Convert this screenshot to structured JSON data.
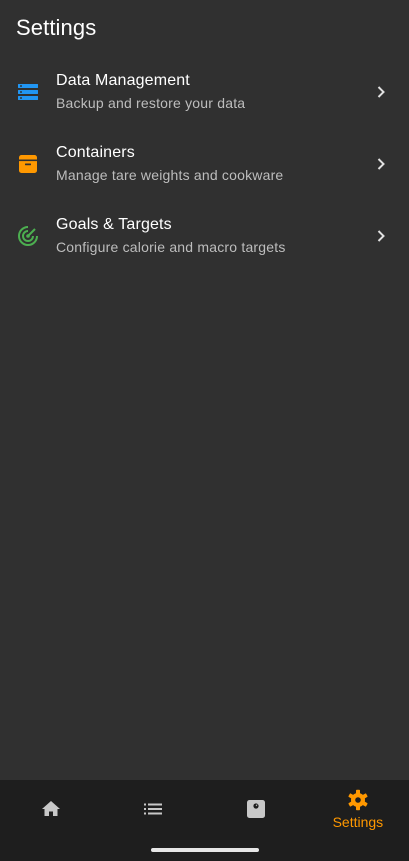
{
  "header": {
    "title": "Settings"
  },
  "settings": {
    "items": [
      {
        "icon": "storage-icon",
        "title": "Data Management",
        "subtitle": "Backup and restore your data",
        "icon_color": "#2196f3"
      },
      {
        "icon": "archive-box-icon",
        "title": "Containers",
        "subtitle": "Manage tare weights and cookware",
        "icon_color": "#ff9800"
      },
      {
        "icon": "target-icon",
        "title": "Goals & Targets",
        "subtitle": "Configure calorie and macro targets",
        "icon_color": "#4caf50"
      }
    ]
  },
  "bottom_nav": {
    "items": [
      {
        "icon": "home-icon",
        "selected": false
      },
      {
        "icon": "list-icon",
        "selected": false
      },
      {
        "icon": "scale-icon",
        "selected": false
      },
      {
        "icon": "gear-icon",
        "label": "Settings",
        "selected": true
      }
    ],
    "active_color": "#ff9800",
    "inactive_color": "#c8c8c8"
  },
  "colors": {
    "background": "#303030",
    "nav_background": "#1e1e1e"
  }
}
